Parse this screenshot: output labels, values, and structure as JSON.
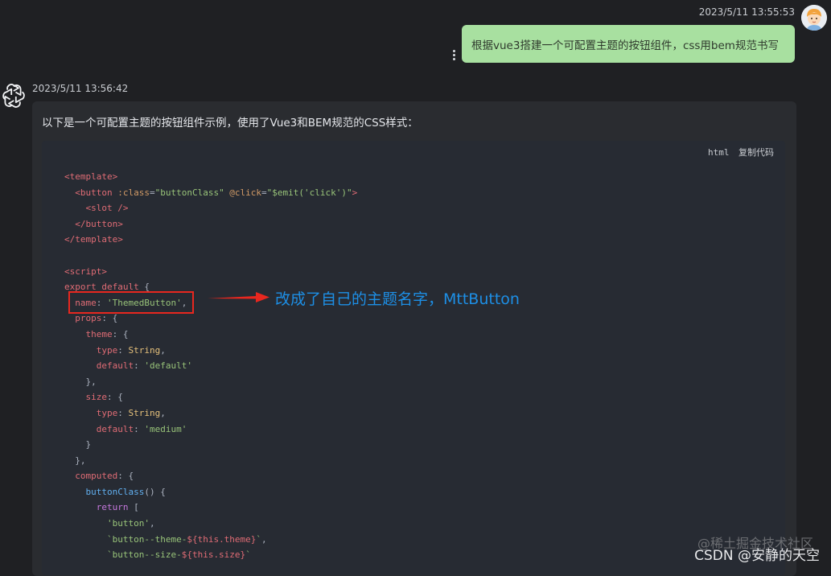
{
  "user_message": {
    "timestamp": "2023/5/11 13:55:53",
    "text": "根据vue3搭建一个可配置主题的按钮组件，css用bem规范书写",
    "avatar": "user-avatar-cartoon"
  },
  "bot_message": {
    "timestamp": "2023/5/11 13:56:42",
    "intro": "以下是一个可配置主题的按钮组件示例，使用了Vue3和BEM规范的CSS样式：",
    "code": {
      "language": "html",
      "copy_label": "复制代码",
      "lines": [
        [
          {
            "c": "tag",
            "t": "<template>"
          }
        ],
        [
          {
            "c": "punc",
            "t": "  "
          },
          {
            "c": "tag",
            "t": "<button"
          },
          {
            "c": "attr",
            "t": " :class"
          },
          {
            "c": "punc",
            "t": "="
          },
          {
            "c": "str",
            "t": "\"buttonClass\""
          },
          {
            "c": "attr",
            "t": " @click"
          },
          {
            "c": "punc",
            "t": "="
          },
          {
            "c": "str",
            "t": "\"$emit('click')\""
          },
          {
            "c": "tag",
            "t": ">"
          }
        ],
        [
          {
            "c": "punc",
            "t": "    "
          },
          {
            "c": "tag",
            "t": "<slot />"
          }
        ],
        [
          {
            "c": "punc",
            "t": "  "
          },
          {
            "c": "tag",
            "t": "</button>"
          }
        ],
        [
          {
            "c": "tag",
            "t": "</template>"
          }
        ],
        [
          {
            "c": "punc",
            "t": ""
          }
        ],
        [
          {
            "c": "tag",
            "t": "<script>"
          }
        ],
        [
          {
            "c": "red",
            "t": "export default"
          },
          {
            "c": "punc",
            "t": " {"
          }
        ],
        [
          {
            "c": "punc",
            "t": "  "
          },
          {
            "c": "prop",
            "t": "name"
          },
          {
            "c": "punc",
            "t": ": "
          },
          {
            "c": "str",
            "t": "'ThemedButton'"
          },
          {
            "c": "punc",
            "t": ","
          }
        ],
        [
          {
            "c": "punc",
            "t": "  "
          },
          {
            "c": "prop",
            "t": "props"
          },
          {
            "c": "punc",
            "t": ": {"
          }
        ],
        [
          {
            "c": "punc",
            "t": "    "
          },
          {
            "c": "prop",
            "t": "theme"
          },
          {
            "c": "punc",
            "t": ": {"
          }
        ],
        [
          {
            "c": "punc",
            "t": "      "
          },
          {
            "c": "prop",
            "t": "type"
          },
          {
            "c": "punc",
            "t": ": "
          },
          {
            "c": "type",
            "t": "String"
          },
          {
            "c": "punc",
            "t": ","
          }
        ],
        [
          {
            "c": "punc",
            "t": "      "
          },
          {
            "c": "prop",
            "t": "default"
          },
          {
            "c": "punc",
            "t": ": "
          },
          {
            "c": "str",
            "t": "'default'"
          }
        ],
        [
          {
            "c": "punc",
            "t": "    },"
          }
        ],
        [
          {
            "c": "punc",
            "t": "    "
          },
          {
            "c": "prop",
            "t": "size"
          },
          {
            "c": "punc",
            "t": ": {"
          }
        ],
        [
          {
            "c": "punc",
            "t": "      "
          },
          {
            "c": "prop",
            "t": "type"
          },
          {
            "c": "punc",
            "t": ": "
          },
          {
            "c": "type",
            "t": "String"
          },
          {
            "c": "punc",
            "t": ","
          }
        ],
        [
          {
            "c": "punc",
            "t": "      "
          },
          {
            "c": "prop",
            "t": "default"
          },
          {
            "c": "punc",
            "t": ": "
          },
          {
            "c": "str",
            "t": "'medium'"
          }
        ],
        [
          {
            "c": "punc",
            "t": "    }"
          }
        ],
        [
          {
            "c": "punc",
            "t": "  },"
          }
        ],
        [
          {
            "c": "punc",
            "t": "  "
          },
          {
            "c": "prop",
            "t": "computed"
          },
          {
            "c": "punc",
            "t": ": {"
          }
        ],
        [
          {
            "c": "punc",
            "t": "    "
          },
          {
            "c": "fn",
            "t": "buttonClass"
          },
          {
            "c": "punc",
            "t": "() {"
          }
        ],
        [
          {
            "c": "punc",
            "t": "      "
          },
          {
            "c": "kw",
            "t": "return"
          },
          {
            "c": "punc",
            "t": " ["
          }
        ],
        [
          {
            "c": "punc",
            "t": "        "
          },
          {
            "c": "str",
            "t": "'button'"
          },
          {
            "c": "punc",
            "t": ","
          }
        ],
        [
          {
            "c": "punc",
            "t": "        "
          },
          {
            "c": "str",
            "t": "`button--theme-"
          },
          {
            "c": "red",
            "t": "${this.theme}"
          },
          {
            "c": "str",
            "t": "`"
          },
          {
            "c": "punc",
            "t": ","
          }
        ],
        [
          {
            "c": "punc",
            "t": "        "
          },
          {
            "c": "str",
            "t": "`button--size-"
          },
          {
            "c": "red",
            "t": "${this.size}"
          },
          {
            "c": "str",
            "t": "`"
          }
        ]
      ]
    }
  },
  "annotation": {
    "text": "改成了自己的主题名字，MttButton",
    "box_color": "#e8271f",
    "text_color": "#1d8fe6"
  },
  "watermark": {
    "top": "@稀土掘金技术社区",
    "bottom": "CSDN @安静的天空"
  }
}
